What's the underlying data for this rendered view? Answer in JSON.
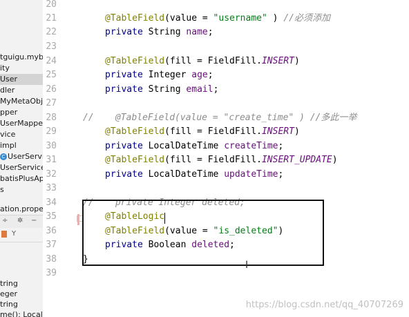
{
  "sidebar": {
    "items": [
      {
        "label": "tguigu.mybati",
        "selected": false
      },
      {
        "label": "ity",
        "selected": false
      },
      {
        "label": "User",
        "selected": true
      },
      {
        "label": "dler",
        "selected": false
      },
      {
        "label": "MyMetaObjec",
        "selected": false
      },
      {
        "label": "pper",
        "selected": false
      },
      {
        "label": "UserMapper",
        "selected": false
      },
      {
        "label": "vice",
        "selected": false
      },
      {
        "label": "impl",
        "selected": false
      },
      {
        "label": "UserServic",
        "selected": false,
        "badge": "C"
      },
      {
        "label": "UserService",
        "selected": false
      },
      {
        "label": "batisPlusAppl",
        "selected": false
      },
      {
        "label": "s",
        "selected": false
      },
      {
        "label": "ation.properti",
        "selected": false
      }
    ],
    "toolbar_icons": [
      "collapse-icon",
      "gear-icon",
      "minus-icon"
    ],
    "toolbar2_icons": [
      "orange-square-icon",
      "filter-icon"
    ],
    "structure_items": [
      {
        "label": "tring"
      },
      {
        "label": "eger"
      },
      {
        "label": "tring"
      },
      {
        "label": "me(): LocalDat"
      }
    ]
  },
  "gutter": {
    "line_numbers": [
      "20",
      "21",
      "22",
      "23",
      "24",
      "25",
      "26",
      "27",
      "28",
      "29",
      "30",
      "31",
      "32",
      "33",
      "34",
      "35",
      "36",
      "37",
      "38",
      "39"
    ]
  },
  "code": {
    "l21": {
      "ann": "@TableField",
      "p1": "(value = ",
      "str": "\"username\"",
      "p2": " ) ",
      "cmt": "//必须添加"
    },
    "l22": {
      "kw": "private",
      "type": " String ",
      "field": "name",
      "end": ";"
    },
    "l24": {
      "ann": "@TableField",
      "p1": "(fill = FieldFill.",
      "const": "INSERT",
      "p2": ")"
    },
    "l25": {
      "kw": "private",
      "type": " Integer ",
      "field": "age",
      "end": ";"
    },
    "l26": {
      "kw": "private",
      "type": " String ",
      "field": "email",
      "end": ";"
    },
    "l28": {
      "cmt": "//    @TableField(value = \"create_time\" ) //多此一举"
    },
    "l29": {
      "ann": "@TableField",
      "p1": "(fill = FieldFill.",
      "const": "INSERT",
      "p2": ")"
    },
    "l30": {
      "kw": "private",
      "type": " LocalDateTime ",
      "field": "createTime",
      "end": ";"
    },
    "l31": {
      "ann": "@TableField",
      "p1": "(fill = FieldFill.",
      "const": "INSERT_UPDATE",
      "p2": ")"
    },
    "l32": {
      "kw": "private",
      "type": " LocalDateTime ",
      "field": "updateTime",
      "end": ";"
    },
    "l34": {
      "cmt": "//    private Integer deleted;"
    },
    "l35": {
      "ann": "@TableLogic"
    },
    "l36": {
      "ann": "@TableField",
      "p1": "(value = ",
      "str": "\"is_deleted\"",
      "p2": ")"
    },
    "l37": {
      "kw": "private",
      "type": " Boolean ",
      "field": "deleted",
      "end": ";"
    },
    "l38": {
      "text": "}"
    }
  },
  "watermark": "https://blog.csdn.net/qq_40707269",
  "colors": {
    "keyword": "#000080",
    "annotation": "#808000",
    "string": "#067d17",
    "field": "#660e7a",
    "comment": "#8c8c8c"
  }
}
